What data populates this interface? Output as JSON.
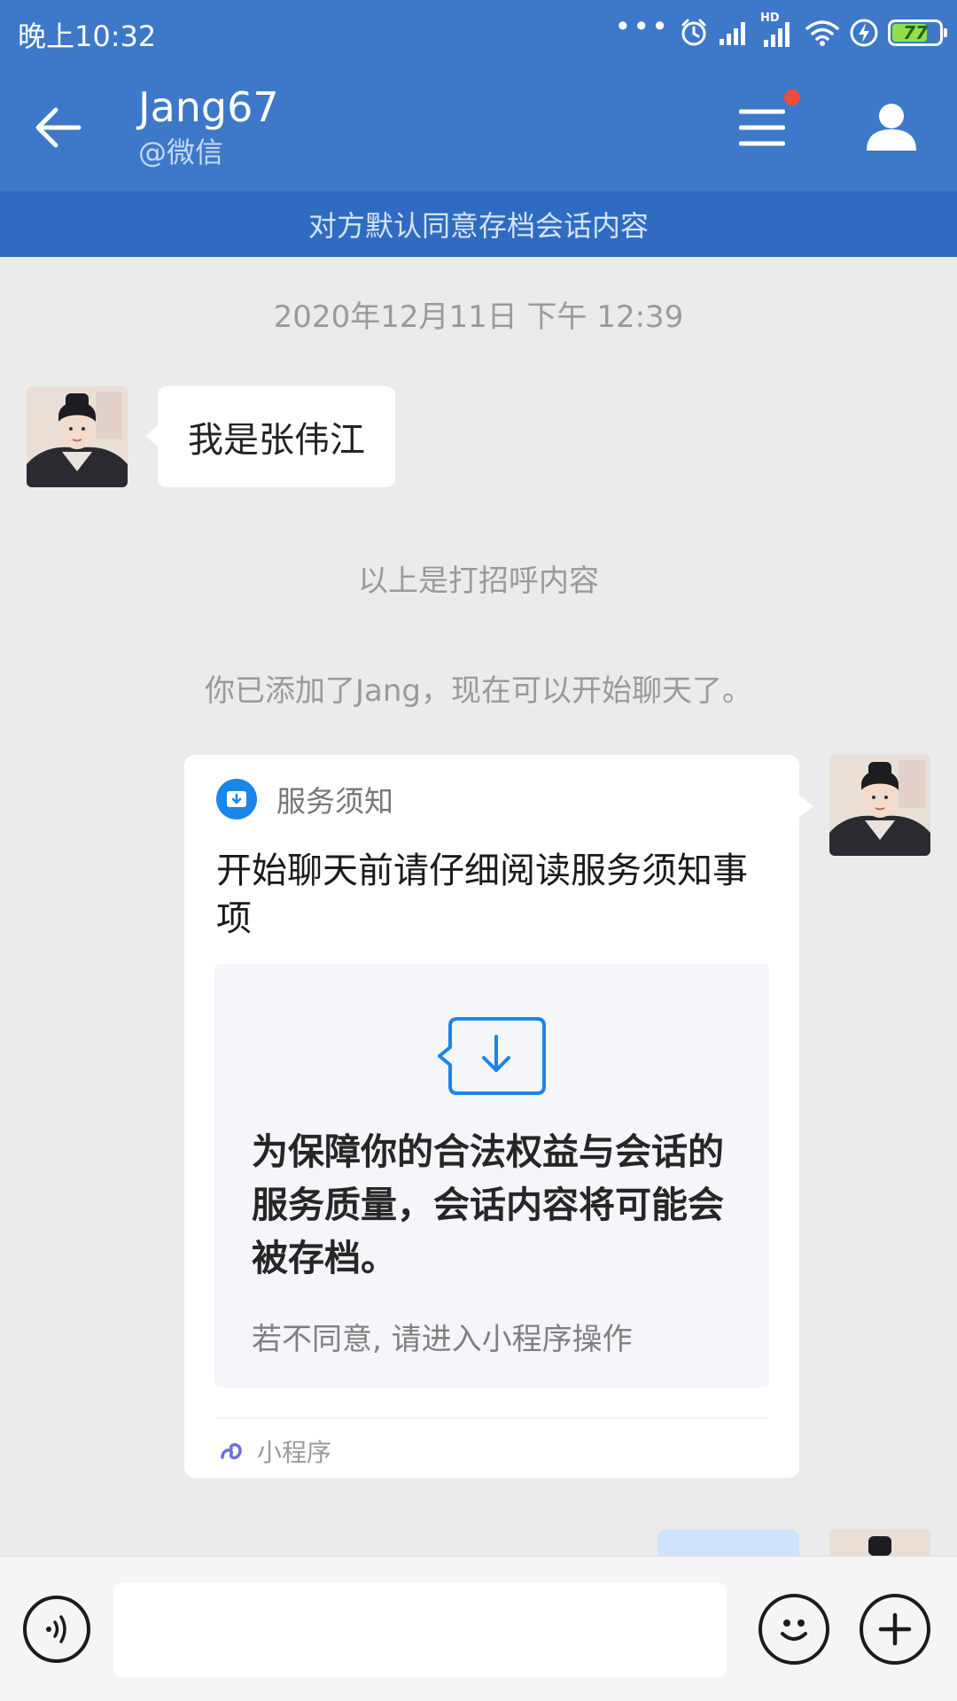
{
  "status_bar": {
    "time": "晚上10:32",
    "dots": "•••",
    "battery_level": "77",
    "battery_fraction": 0.77,
    "network_label": "HD",
    "icons": [
      "more-dots-icon",
      "alarm-icon",
      "cell-signal-icon",
      "hd-cell-signal-icon",
      "wifi-icon",
      "charging-icon",
      "battery-icon"
    ]
  },
  "header": {
    "contact_name": "Jang67",
    "contact_source": "@微信",
    "icons": [
      "back-arrow-icon",
      "menu-icon",
      "profile-icon"
    ],
    "accent_color": "#3d78c9",
    "notification_dot_color": "#f14b3e"
  },
  "archive_banner": "对方默认同意存档会话内容",
  "chat": {
    "timestamp": "2020年12月11日  下午 12:39",
    "greeting_message": "我是张伟江",
    "greeting_note": "以上是打招呼内容",
    "added_note": "你已添加了Jang，现在可以开始聊天了。"
  },
  "service_card": {
    "source_label": "服务须知",
    "title": "开始聊天前请仔细阅读服务须知事项",
    "body": "为保障你的合法权益与会话的服务质量，会话内容将可能会被存档。",
    "sub_text": "若不同意, 请进入小程序操作",
    "footer_label": "小程序",
    "icons": [
      "download-badge-icon",
      "download-message-icon",
      "mini-program-icon"
    ],
    "icon_color": "#1c86e8"
  },
  "input_bar": {
    "placeholder": "",
    "icons": [
      "voice-icon",
      "emoji-icon",
      "plus-icon"
    ]
  }
}
